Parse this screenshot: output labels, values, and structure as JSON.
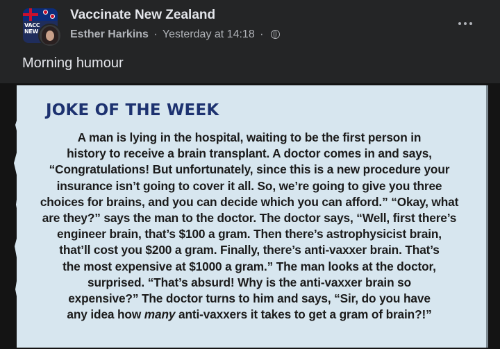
{
  "header": {
    "group_name": "Vaccinate New Zealand",
    "author": "Esther Harkins",
    "separator": "·",
    "timestamp": "Yesterday at 14:18",
    "separator2": "·",
    "privacy_icon": "globe-icon",
    "more_icon": "more-horizontal-icon",
    "avatar_text_line1": "VACC",
    "avatar_text_line2": "NEW Z"
  },
  "post": {
    "text": "Morning humour"
  },
  "image": {
    "title": "JOKE OF THE WEEK",
    "lines": [
      "A man is lying in the hospital, waiting to be the first person in",
      "history to receive a brain transplant. A doctor comes in and says,",
      "“Congratulations! But unfortunately, since this is a new procedure your",
      "insurance isn’t going to cover it all. So, we’re going to give you three",
      "choices for brains, and you can decide which you can afford.” “Okay, what",
      "are they?” says the man to the doctor. The doctor says, “Well, first there’s",
      "engineer brain, that’s $100 a gram. Then there’s astrophysicist brain,",
      "that’ll cost you $200 a gram. Finally, there’s anti-vaxxer brain. That’s",
      "the most expensive at $1000 a gram.” The man looks at the doctor,",
      "surprised. “That’s absurd! Why is the anti-vaxxer brain so",
      "expensive?” The doctor turns to him and says, “Sir, do you have"
    ],
    "last_line_before": "any idea how ",
    "last_line_emphasis": "many",
    "last_line_after": " anti-vaxxers it takes to get a gram of brain?!”",
    "colors": {
      "card_background": "#d7e6ef",
      "title_color": "#1d3270",
      "body_color": "#1a1a1a"
    }
  }
}
